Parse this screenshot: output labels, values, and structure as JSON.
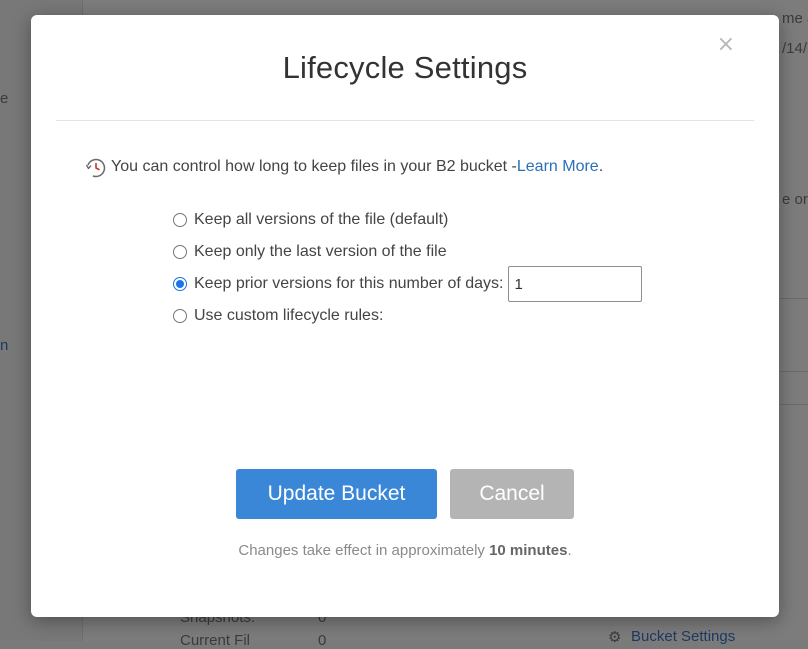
{
  "background": {
    "top_right_1": "me a",
    "top_right_2": "/14/",
    "left_fragment_1": "e",
    "right_fragment": "e or",
    "left_fragment_2": "n",
    "bottom_label_1": "Snapshots:",
    "bottom_value_1": "0",
    "bottom_label_2": "Current Fil",
    "bottom_value_2": "0",
    "bucket_settings_link": "Bucket Settings"
  },
  "modal": {
    "title": "Lifecycle Settings",
    "close_label": "×",
    "intro_text": "You can control how long to keep files in your B2 bucket - ",
    "intro_link": "Learn More",
    "intro_period": ".",
    "options": [
      {
        "label": "Keep all versions of the file (default)",
        "checked": false
      },
      {
        "label": "Keep only the last version of the file",
        "checked": false
      },
      {
        "label": "Keep prior versions for this number of days:",
        "checked": true
      },
      {
        "label": "Use custom lifecycle rules:",
        "checked": false
      }
    ],
    "days_value": "1",
    "update_button": "Update Bucket",
    "cancel_button": "Cancel",
    "note_prefix": "Changes take effect in approximately ",
    "note_bold": "10 minutes",
    "note_suffix": "."
  },
  "colors": {
    "primary": "#3a87d8",
    "cancel": "#b4b4b4",
    "link": "#2c6fb4",
    "radio_checked": "#1a73e8"
  }
}
